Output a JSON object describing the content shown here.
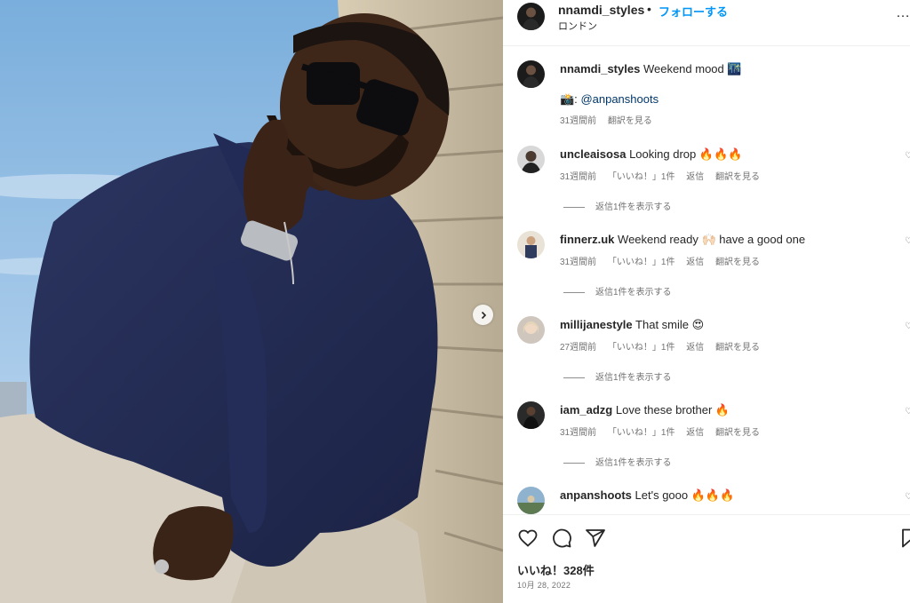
{
  "post": {
    "username": "nnamdi_styles",
    "dot": "•",
    "follow_label": "フォローする",
    "location": "ロンドン",
    "more_label": "…"
  },
  "caption": {
    "username": "nnamdi_styles",
    "text": "Weekend mood 🌃",
    "credit_prefix": "📸:",
    "credit_mention": "@anpanshoots",
    "time": "31週間前",
    "translate_label": "翻訳を見る"
  },
  "comments": [
    {
      "username": "uncleaisosa",
      "text": "Looking drop 🔥🔥🔥",
      "time": "31週間前",
      "likes": "「いいね！」1件",
      "reply_label": "返信",
      "translate_label": "翻訳を見る",
      "view_replies": "返信1件を表示する"
    },
    {
      "username": "finnerz.uk",
      "text": "Weekend ready 🙌🏻 have a good one",
      "time": "31週間前",
      "likes": "「いいね！」1件",
      "reply_label": "返信",
      "translate_label": "翻訳を見る",
      "view_replies": "返信1件を表示する"
    },
    {
      "username": "millijanestyle",
      "text": "That smile 😍",
      "time": "27週間前",
      "likes": "「いいね！」1件",
      "reply_label": "返信",
      "translate_label": "翻訳を見る",
      "view_replies": "返信1件を表示する"
    },
    {
      "username": "iam_adzg",
      "text": "Love these brother 🔥",
      "time": "31週間前",
      "likes": "「いいね！」1件",
      "reply_label": "返信",
      "translate_label": "翻訳を見る",
      "view_replies": "返信1件を表示する"
    },
    {
      "username": "anpanshoots",
      "text": "Let's gooo 🔥🔥🔥"
    }
  ],
  "footer": {
    "likes_count": "いいね！328件",
    "date": "10月 28, 2022"
  },
  "icons": {
    "like": "heart-icon",
    "comment": "comment-icon",
    "share": "share-icon",
    "save": "bookmark-icon",
    "next": "chevron-right-icon"
  },
  "colors": {
    "link_blue": "#0095f6",
    "mention_blue": "#00376b",
    "secondary_text": "#737373"
  }
}
